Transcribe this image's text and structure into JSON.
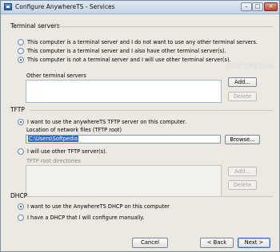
{
  "window": {
    "title": "Configure AnywhereTS - Services",
    "min_glyph": "–",
    "max_glyph": "□",
    "close_glyph": "✕"
  },
  "terminal_servers": {
    "heading": "Terminal servers",
    "options": [
      {
        "label": "This computer is a terminal server and I do not want to use any other terminal servers.",
        "checked": false
      },
      {
        "label": "This computer is a terminal server and I also have other terminal server(s).",
        "checked": false
      },
      {
        "label": "This computer is not a terminal server and I will use other terminal server(s).",
        "checked": true
      }
    ],
    "list_label": "Other terminal servers",
    "add_label": "Add...",
    "delete_label": "Delete"
  },
  "tftp": {
    "heading": "TFTP",
    "use_own_label": "I want to use the anywhereTS TFTP server on this computer.",
    "use_own_checked": true,
    "location_label": "Location of network files (TFTP root)",
    "location_value": "C:\\Users\\Softpedia",
    "browse_label": "Browse...",
    "use_other_label": "I will use other TFTP server(s).",
    "use_other_checked": false,
    "root_dirs_label": "TFTP root directories",
    "add_label": "Add...",
    "delete_label": "Delete"
  },
  "dhcp": {
    "heading": "DHCP",
    "use_own_label": "I want to use the AnywhereTS DHCP on this computer",
    "use_own_checked": true,
    "own_server_label": "I have a DHCP that I will configure manually.",
    "own_server_checked": false
  },
  "footer": {
    "cancel_label": "Cancel",
    "back_label": "< Back",
    "next_label": "Next >"
  },
  "watermark": "SOFTPEDIA"
}
